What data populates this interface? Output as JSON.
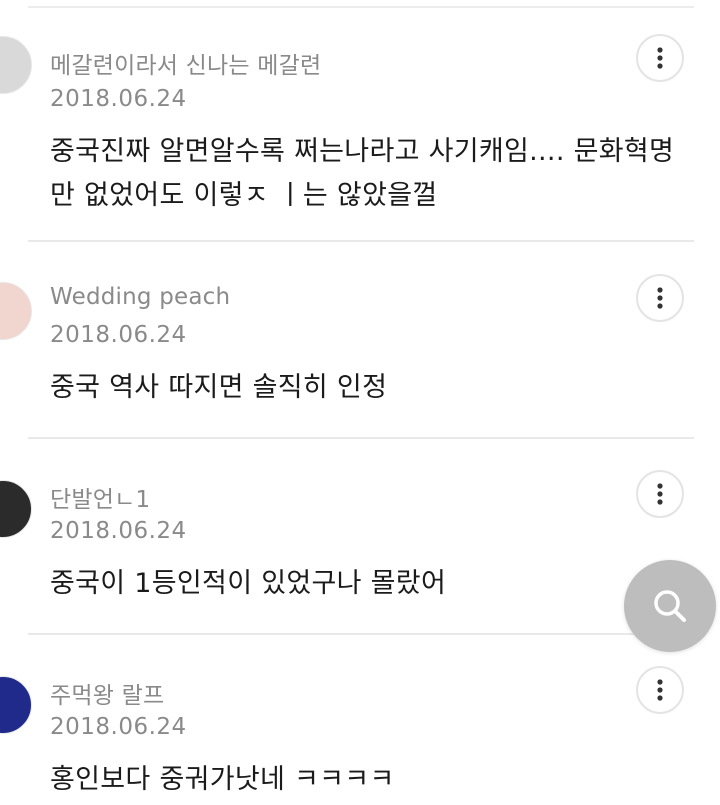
{
  "comments": [
    {
      "author": "메갈련이라서 신나는 메갈련",
      "date": "2018.06.24",
      "text": "중국진짜 알면알수록 쩌는나라고 사기캐임.... 문화혁명만 없었어도 이렇ㅈ ㅣ는 않았을껄",
      "avatar_color": "#d9d9d9"
    },
    {
      "author": "Wedding peach",
      "date": "2018.06.24",
      "text": "중국 역사 따지면 솔직히 인정",
      "avatar_color": "#f1d6cf"
    },
    {
      "author": "단발언ㄴ1",
      "date": "2018.06.24",
      "text": "중국이 1등인적이 있었구나 몰랐어",
      "avatar_color": "#2b2b2b"
    },
    {
      "author": "주먹왕 랄프",
      "date": "2018.06.24",
      "text": "홍인보다 중궈가낫네 ㅋㅋㅋㅋ",
      "avatar_color": "#1f2a8a"
    }
  ],
  "icons": {
    "more": "more-vertical-icon",
    "search": "search-icon"
  },
  "colors": {
    "meta_text": "#8a8a8a",
    "body_text": "#1b1b1b",
    "divider": "#e9e9e9",
    "fab": "#bdbdbd"
  }
}
